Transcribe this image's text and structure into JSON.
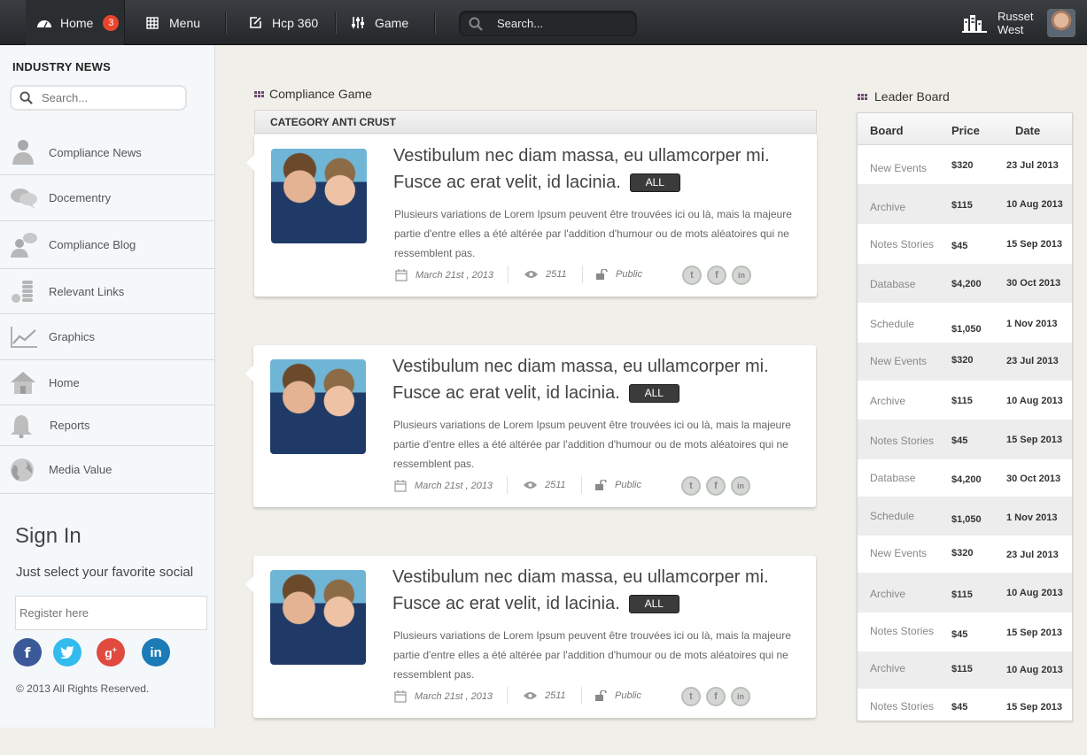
{
  "nav": {
    "home_label": "Home",
    "home_badge": "3",
    "menu_label": "Menu",
    "hcp_label": "Hcp 360",
    "game_label": "Game",
    "search_placeholder": "Search..."
  },
  "user": {
    "first": "Russet",
    "last": "West"
  },
  "sidebar": {
    "title": "INDUSTRY NEWS",
    "search_placeholder": "Search...",
    "items": [
      {
        "label": "Compliance News",
        "icon": "person-icon"
      },
      {
        "label": "Docementry",
        "icon": "chat-bubbles-icon"
      },
      {
        "label": "Compliance Blog",
        "icon": "user-comment-icon"
      },
      {
        "label": "Relevant Links",
        "icon": "coins-icon"
      },
      {
        "label": "Graphics",
        "icon": "line-chart-icon"
      },
      {
        "label": "Home",
        "icon": "house-icon"
      },
      {
        "label": "Reports",
        "icon": "bell-icon"
      },
      {
        "label": "Media Value",
        "icon": "globe-icon"
      }
    ],
    "signin_title": "Sign In",
    "signin_sub": "Just select your favorite social",
    "register_placeholder": "Register here",
    "copyright": "© 2013 All Rights Reserved.",
    "social_colors": {
      "facebook": "#3b5998",
      "twitter": "#33bbee",
      "google": "#e04a3f",
      "linkedin": "#1c7bb7"
    }
  },
  "main": {
    "section_title": "Compliance Game",
    "category": "CATEGORY ANTI CRUST",
    "cards": [
      {
        "headline_1": "Vestibulum nec diam massa, eu ullamcorper mi.",
        "headline_2": "Fusce ac erat velit, id lacinia.",
        "pill": "ALL",
        "body": "Plusieurs variations de Lorem Ipsum peuvent être trouvées ici ou là, mais la majeure partie d'entre elles a été altérée par l'addition d'humour ou de mots aléatoires qui ne ressemblent pas.",
        "date": "March 21st , 2013",
        "views": "2511",
        "visibility": "Public"
      },
      {
        "headline_1": "Vestibulum nec diam massa, eu ullamcorper mi.",
        "headline_2": "Fusce ac erat velit, id lacinia.",
        "pill": "ALL",
        "body": "Plusieurs variations de Lorem Ipsum peuvent être trouvées ici ou là, mais la majeure partie d'entre elles a été altérée par l'addition d'humour ou de mots aléatoires qui ne ressemblent pas.",
        "date": "March 21st , 2013",
        "views": "2511",
        "visibility": "Public"
      },
      {
        "headline_1": "Vestibulum nec diam massa, eu ullamcorper mi.",
        "headline_2": "Fusce ac erat velit, id lacinia.",
        "pill": "ALL",
        "body": "Plusieurs variations de Lorem Ipsum peuvent être trouvées ici ou là, mais la majeure partie d'entre elles a été altérée par l'addition d'humour ou de mots aléatoires qui ne ressemblent pas.",
        "date": "March 21st , 2013",
        "views": "2511",
        "visibility": "Public"
      }
    ]
  },
  "leaderboard": {
    "title": "Leader Board",
    "headers": [
      "Board",
      "Price",
      "Date"
    ],
    "rows": [
      {
        "board": "New Events",
        "price": "$320",
        "date": "23 Jul 2013"
      },
      {
        "board": "Archive",
        "price": "$115",
        "date": "10 Aug 2013"
      },
      {
        "board": "Notes Stories",
        "price": "$45",
        "date": "15 Sep 2013"
      },
      {
        "board": "Database",
        "price": "$4,200",
        "date": "30 Oct 2013"
      },
      {
        "board": "Schedule",
        "price": "$1,050",
        "date": "1 Nov 2013"
      },
      {
        "board": "New Events",
        "price": "$320",
        "date": "23 Jul 2013"
      },
      {
        "board": "Archive",
        "price": "$115",
        "date": "10 Aug 2013"
      },
      {
        "board": "Notes Stories",
        "price": "$45",
        "date": "15 Sep 2013"
      },
      {
        "board": "Database",
        "price": "$4,200",
        "date": "30 Oct 2013"
      },
      {
        "board": "Schedule",
        "price": "$1,050",
        "date": "1 Nov 2013"
      },
      {
        "board": "New Events",
        "price": "$320",
        "date": "23 Jul 2013"
      },
      {
        "board": "Archive",
        "price": "$115",
        "date": "10 Aug 2013"
      },
      {
        "board": "Notes Stories",
        "price": "$45",
        "date": "15 Sep 2013"
      },
      {
        "board": "Archive",
        "price": "$115",
        "date": "10 Aug 2013"
      },
      {
        "board": "Notes Stories",
        "price": "$45",
        "date": "15 Sep 2013"
      }
    ]
  }
}
